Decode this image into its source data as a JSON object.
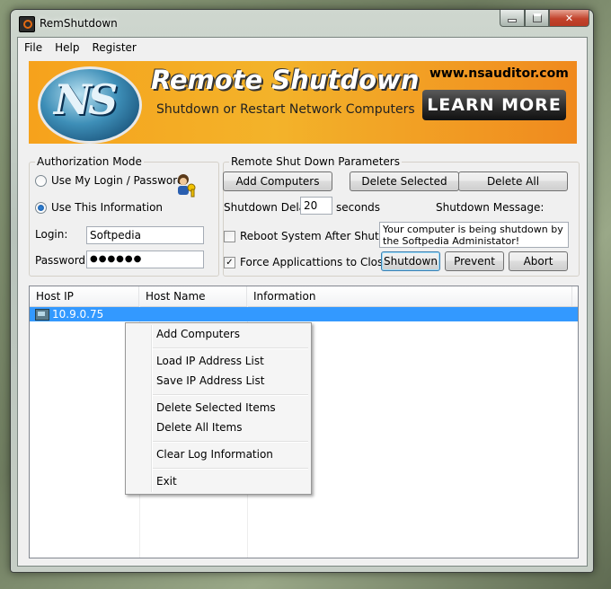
{
  "window": {
    "title": "RemShutdown"
  },
  "menu": [
    "File",
    "Help",
    "Register"
  ],
  "banner": {
    "logo_text": "NS",
    "title": "Remote Shutdown",
    "subtitle": "Shutdown or Restart Network Computers",
    "url": "www.nsauditor.com",
    "learn_more": "LEARN MORE"
  },
  "auth": {
    "group_label": "Authorization Mode",
    "option_login": "Use My Login / Password",
    "option_info": "Use This Information",
    "selected": "Use This Information",
    "login_label": "Login:",
    "login_value": "Softpedia",
    "password_label": "Password:",
    "password_value": "●●●●●●"
  },
  "params": {
    "group_label": "Remote Shut Down Parameters",
    "add_computers": "Add Computers",
    "delete_selected": "Delete Selected",
    "delete_all": "Delete All",
    "delay_label": "Shutdown Delay:",
    "delay_value": "20",
    "delay_unit": "seconds",
    "message_label": "Shutdown Message:",
    "message_value": "Your computer is being shutdown by the Softpedia Administator!",
    "reboot_label": "Reboot System After Shutdown",
    "reboot_checked": false,
    "force_label": "Force Applicattions to Close",
    "force_checked": true,
    "shutdown": "Shutdown",
    "prevent": "Prevent",
    "abort": "Abort"
  },
  "list": {
    "columns": [
      "Host IP",
      "Host Name",
      "Information"
    ],
    "rows": [
      {
        "ip": "10.9.0.75",
        "name": "",
        "info": ""
      }
    ]
  },
  "context_menu": {
    "items": [
      "Add Computers",
      "Load IP Address List",
      "Save IP Address List",
      "Delete Selected Items",
      "Delete All Items",
      "Clear Log Information",
      "Exit"
    ]
  },
  "colors": {
    "selection": "#3399ff",
    "banner_orange": "#f6a21c"
  }
}
